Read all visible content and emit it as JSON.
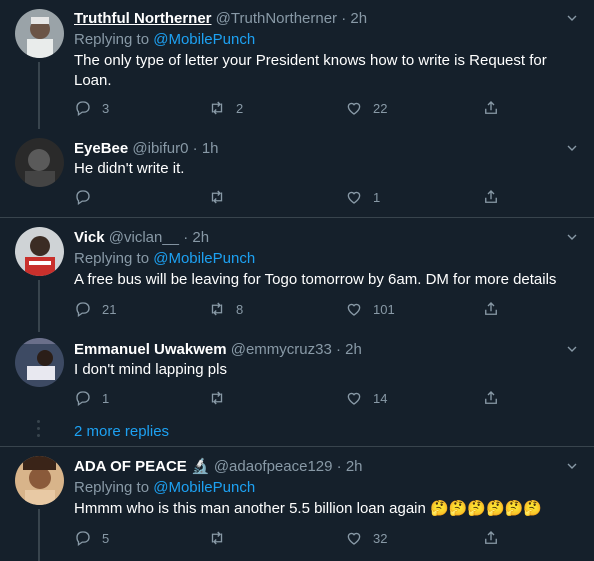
{
  "tweets": [
    {
      "name": "Truthful Northerner",
      "handle": "@TruthNortherner",
      "time": "· 2h",
      "replying_label": "Replying to",
      "replying_to": "@MobilePunch",
      "text": "The only type of letter your President knows how to write is Request for Loan.",
      "replies": "3",
      "retweets": "2",
      "likes": "22"
    },
    {
      "name": "EyeBee",
      "handle": "@ibifur0",
      "time": "· 1h",
      "text": "He didn't write it.",
      "replies": "",
      "retweets": "",
      "likes": "1"
    },
    {
      "name": "Vick",
      "handle": "@viclan__",
      "time": "· 2h",
      "replying_label": "Replying to",
      "replying_to": "@MobilePunch",
      "text": "A free bus will be leaving for Togo tomorrow by 6am. DM for more details",
      "replies": "21",
      "retweets": "8",
      "likes": "101"
    },
    {
      "name": "Emmanuel Uwakwem",
      "handle": "@emmycruz33",
      "time": "· 2h",
      "text": "I don't mind lapping pls",
      "replies": "1",
      "retweets": "",
      "likes": "14"
    },
    {
      "name": "ADA OF PEACE",
      "name_emoji": "🔬",
      "handle": "@adaofpeace129",
      "time": "· 2h",
      "replying_label": "Replying to",
      "replying_to": "@MobilePunch",
      "text": "Hmmm who is this man another 5.5 billion loan again 🤔🤔🤔🤔🤔🤔",
      "replies": "5",
      "retweets": "",
      "likes": "32"
    }
  ],
  "more_replies": "2 more replies",
  "icons": {
    "reply": "reply-icon",
    "retweet": "retweet-icon",
    "like": "heart-icon",
    "share": "share-icon",
    "caret": "chevron-down-icon"
  },
  "colors": {
    "background": "#15202b",
    "divider": "#38444d",
    "muted": "#8899a6",
    "link": "#1da1f2"
  }
}
